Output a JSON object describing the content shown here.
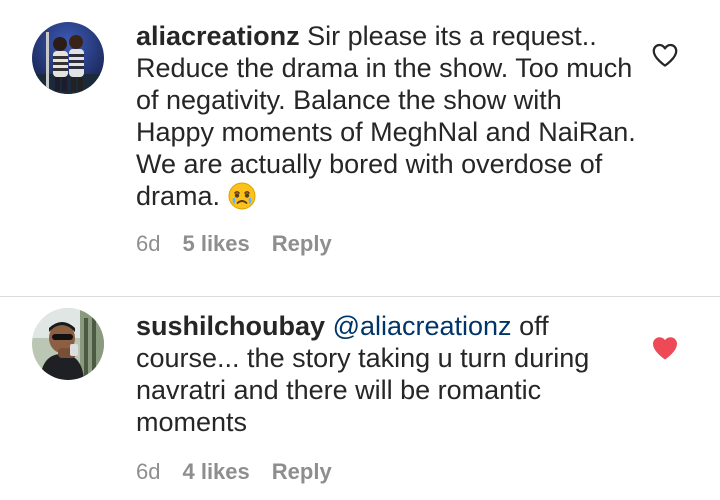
{
  "comments": [
    {
      "username": "aliacreationz",
      "text": " Sir please its a request.. Reduce the drama in the show. Too much of negativity. Balance the show with Happy moments of MeghNal and NaiRan. We are actually bored with overdose of drama. ",
      "emoji": "crying-face-emoji",
      "time": "6d",
      "likes": "5 likes",
      "reply": "Reply",
      "liked": false,
      "heart_icon": "heart-outline-icon"
    },
    {
      "username": "sushilchoubay",
      "mention": "@aliacreationz",
      "text": " off course... the story taking u turn during navratri and there will be romantic moments",
      "time": "6d",
      "likes": "4 likes",
      "reply": "Reply",
      "liked": true,
      "heart_icon": "heart-filled-icon",
      "heart_color": "#ed4956"
    }
  ],
  "colors": {
    "text": "#262626",
    "meta": "#8e8e8e",
    "mention": "#003569",
    "liked_heart": "#ed4956",
    "divider": "#dbdbdb"
  }
}
